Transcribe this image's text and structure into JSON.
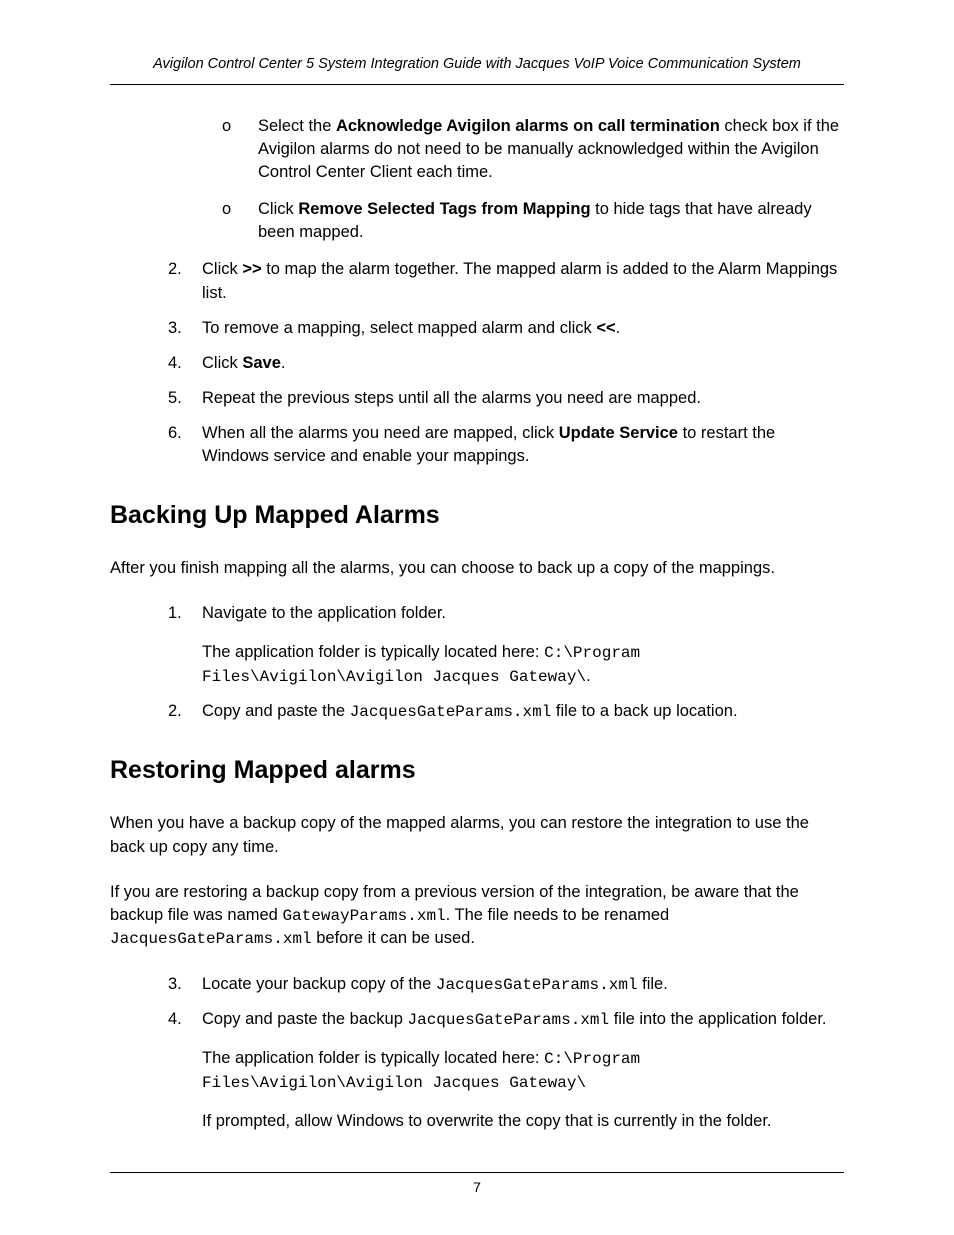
{
  "header": "Avigilon Control Center 5 System Integration Guide with Jacques VoIP Voice Communication System",
  "pageNumber": "7",
  "topSubList": [
    {
      "bullet": "o",
      "runs": [
        {
          "t": "Select the "
        },
        {
          "t": "Acknowledge Avigilon alarms on call termination",
          "b": true
        },
        {
          "t": " check box if the Avigilon alarms do not need to be manually acknowledged within the Avigilon Control Center Client each time."
        }
      ]
    },
    {
      "bullet": "o",
      "runs": [
        {
          "t": "Click "
        },
        {
          "t": "Remove Selected Tags from Mapping",
          "b": true
        },
        {
          "t": " to hide tags that have already been mapped."
        }
      ]
    }
  ],
  "topOrdered": [
    {
      "num": "2.",
      "runs": [
        {
          "t": "Click "
        },
        {
          "t": ">>",
          "b": true
        },
        {
          "t": " to map the alarm together. The mapped alarm is added to the Alarm Mappings list."
        }
      ]
    },
    {
      "num": "3.",
      "runs": [
        {
          "t": "To remove a mapping, select mapped alarm and click "
        },
        {
          "t": "<<",
          "b": true
        },
        {
          "t": "."
        }
      ]
    },
    {
      "num": "4.",
      "runs": [
        {
          "t": "Click "
        },
        {
          "t": "Save",
          "b": true
        },
        {
          "t": "."
        }
      ]
    },
    {
      "num": "5.",
      "runs": [
        {
          "t": "Repeat the previous steps until all the alarms you need are mapped."
        }
      ]
    },
    {
      "num": "6.",
      "runs": [
        {
          "t": "When all the alarms you need are mapped, click "
        },
        {
          "t": "Update Service",
          "b": true
        },
        {
          "t": " to restart the Windows service and enable your mappings."
        }
      ]
    }
  ],
  "section1": {
    "heading": "Backing Up Mapped Alarms",
    "intro": "After you finish mapping all the alarms, you can choose to back up a copy of the mappings.",
    "items": [
      {
        "num": "1.",
        "runs": [
          {
            "t": "Navigate to the application folder."
          }
        ],
        "after": [
          {
            "runs": [
              {
                "t": "The application folder is typically located here: "
              },
              {
                "t": "C:\\Program Files\\Avigilon\\Avigilon Jacques Gateway\\",
                "mono": true
              },
              {
                "t": "."
              }
            ]
          }
        ]
      },
      {
        "num": "2.",
        "runs": [
          {
            "t": "Copy and paste the "
          },
          {
            "t": "JacquesGateParams.xml",
            "mono": true
          },
          {
            "t": " file to a back up location."
          }
        ]
      }
    ]
  },
  "section2": {
    "heading": "Restoring Mapped alarms",
    "intro1": "When you have a backup copy of the mapped alarms, you can restore the integration to use the back up copy any time.",
    "intro2_runs": [
      {
        "t": "If you are restoring a backup copy from a previous version of the integration, be aware that the backup file was named "
      },
      {
        "t": "GatewayParams.xml",
        "mono": true
      },
      {
        "t": ". The file needs to be renamed "
      },
      {
        "t": "JacquesGateParams.xml",
        "mono": true
      },
      {
        "t": " before it can be used."
      }
    ],
    "items": [
      {
        "num": "3.",
        "runs": [
          {
            "t": "Locate your backup copy of the "
          },
          {
            "t": "JacquesGateParams.xml",
            "mono": true
          },
          {
            "t": " file."
          }
        ]
      },
      {
        "num": "4.",
        "runs": [
          {
            "t": "Copy and paste the backup "
          },
          {
            "t": "JacquesGateParams.xml",
            "mono": true
          },
          {
            "t": " file into the application folder."
          }
        ],
        "after": [
          {
            "runs": [
              {
                "t": "The application folder is typically located here: "
              },
              {
                "t": "C:\\Program Files\\Avigilon\\Avigilon Jacques Gateway\\",
                "mono": true
              }
            ]
          },
          {
            "runs": [
              {
                "t": "If prompted, allow Windows to overwrite the copy that is currently in the folder."
              }
            ]
          }
        ]
      }
    ]
  }
}
